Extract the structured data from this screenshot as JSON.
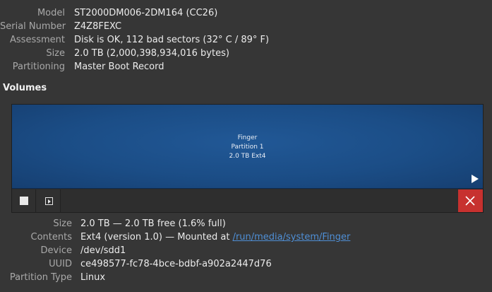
{
  "disk": {
    "model_label": "Model",
    "model": "ST2000DM006-2DM164 (CC26)",
    "serial_label": "Serial Number",
    "serial": "Z4Z8FEXC",
    "assessment_label": "Assessment",
    "assessment": "Disk is OK, 112 bad sectors (32° C / 89° F)",
    "size_label": "Size",
    "size": "2.0 TB (2,000,398,934,016 bytes)",
    "partitioning_label": "Partitioning",
    "partitioning": "Master Boot Record"
  },
  "volumes": {
    "title": "Volumes",
    "partition": {
      "name": "Finger",
      "number": "Partition 1",
      "size_fs": "2.0 TB Ext4"
    }
  },
  "details": {
    "size_label": "Size",
    "size": "2.0 TB — 2.0 TB free (1.6% full)",
    "contents_label": "Contents",
    "contents_prefix": "Ext4 (version 1.0) — Mounted at ",
    "mount_path": "/run/media/system/Finger",
    "device_label": "Device",
    "device": "/dev/sdd1",
    "uuid_label": "UUID",
    "uuid": "ce498577-fc78-4bce-bdbf-a902a2447d76",
    "ptype_label": "Partition Type",
    "ptype": "Linux"
  },
  "colors": {
    "partition_fill": "#1b4d86",
    "delete_button": "#c7312f",
    "link": "#4f8fd6"
  },
  "icons": {
    "stop": "stop-icon",
    "unmount": "unmount-icon",
    "play": "play-icon",
    "delete": "close-icon"
  }
}
